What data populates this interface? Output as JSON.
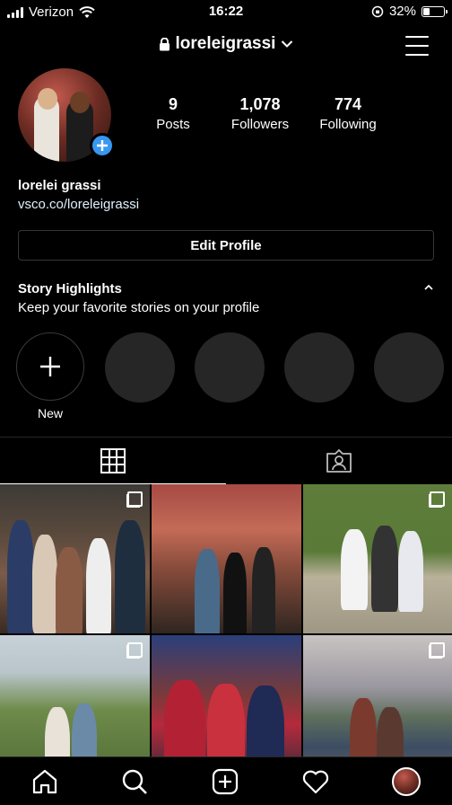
{
  "status_bar": {
    "carrier": "Verizon",
    "time": "16:22",
    "battery_percent": "32%",
    "battery_level": 0.32
  },
  "header": {
    "username": "loreleigrassi"
  },
  "profile": {
    "stats": [
      {
        "value": "9",
        "label": "Posts"
      },
      {
        "value": "1,078",
        "label": "Followers"
      },
      {
        "value": "774",
        "label": "Following"
      }
    ],
    "full_name": "lorelei grassi",
    "website": "vsco.co/loreleigrassi",
    "edit_button": "Edit Profile"
  },
  "highlights": {
    "title": "Story Highlights",
    "subtitle": "Keep your favorite stories on your profile",
    "new_label": "New"
  },
  "colors": {
    "accent_blue": "#3897f0",
    "background": "#000000",
    "placeholder": "#262626"
  }
}
